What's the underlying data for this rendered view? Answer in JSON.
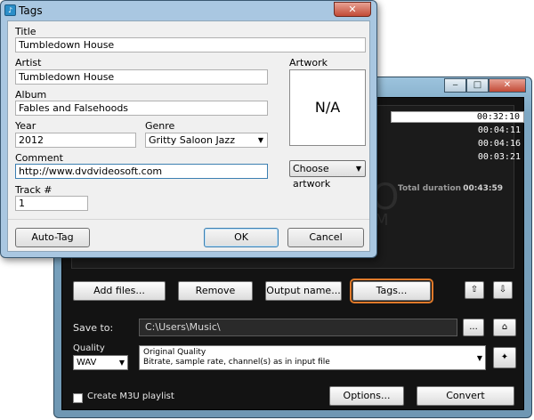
{
  "dialog": {
    "title": "Tags",
    "fields": {
      "title_label": "Title",
      "title_value": "Tumbledown House",
      "artist_label": "Artist",
      "artist_value": "Tumbledown House",
      "album_label": "Album",
      "album_value": "Fables and Falsehoods",
      "year_label": "Year",
      "year_value": "2012",
      "genre_label": "Genre",
      "genre_value": "Gritty Saloon Jazz",
      "comment_label": "Comment",
      "comment_value": "http://www.dvdvideosoft.com",
      "track_label": "Track #",
      "track_value": "1"
    },
    "artwork": {
      "label": "Artwork",
      "placeholder": "N/A",
      "choose_label": "Choose artwork"
    },
    "buttons": {
      "auto_tag": "Auto-Tag",
      "ok": "OK",
      "cancel": "Cancel"
    }
  },
  "app": {
    "durations": [
      "00:32:10",
      "00:04:11",
      "00:04:16",
      "00:03:21"
    ],
    "total_label": "Total duration",
    "total_value": "00:43:59",
    "buttons": {
      "add_files": "Add files...",
      "remove": "Remove",
      "output_name": "Output name...",
      "tags": "Tags...",
      "options": "Options...",
      "convert": "Convert",
      "browse": "...",
      "move_up": "⇧",
      "move_down": "⇩"
    },
    "save_to_label": "Save to:",
    "save_to_value": "C:\\Users\\Music\\",
    "quality_label": "Quality",
    "format_value": "WAV",
    "quality_title": "Original Quality",
    "quality_desc": "Bitrate, sample rate, channel(s) as in input file",
    "m3u_label": "Create M3U playlist"
  },
  "colors": {
    "focus_ring": "#e07a2a",
    "window_frame": "#a9c7e1",
    "dark_panel": "#131313"
  }
}
